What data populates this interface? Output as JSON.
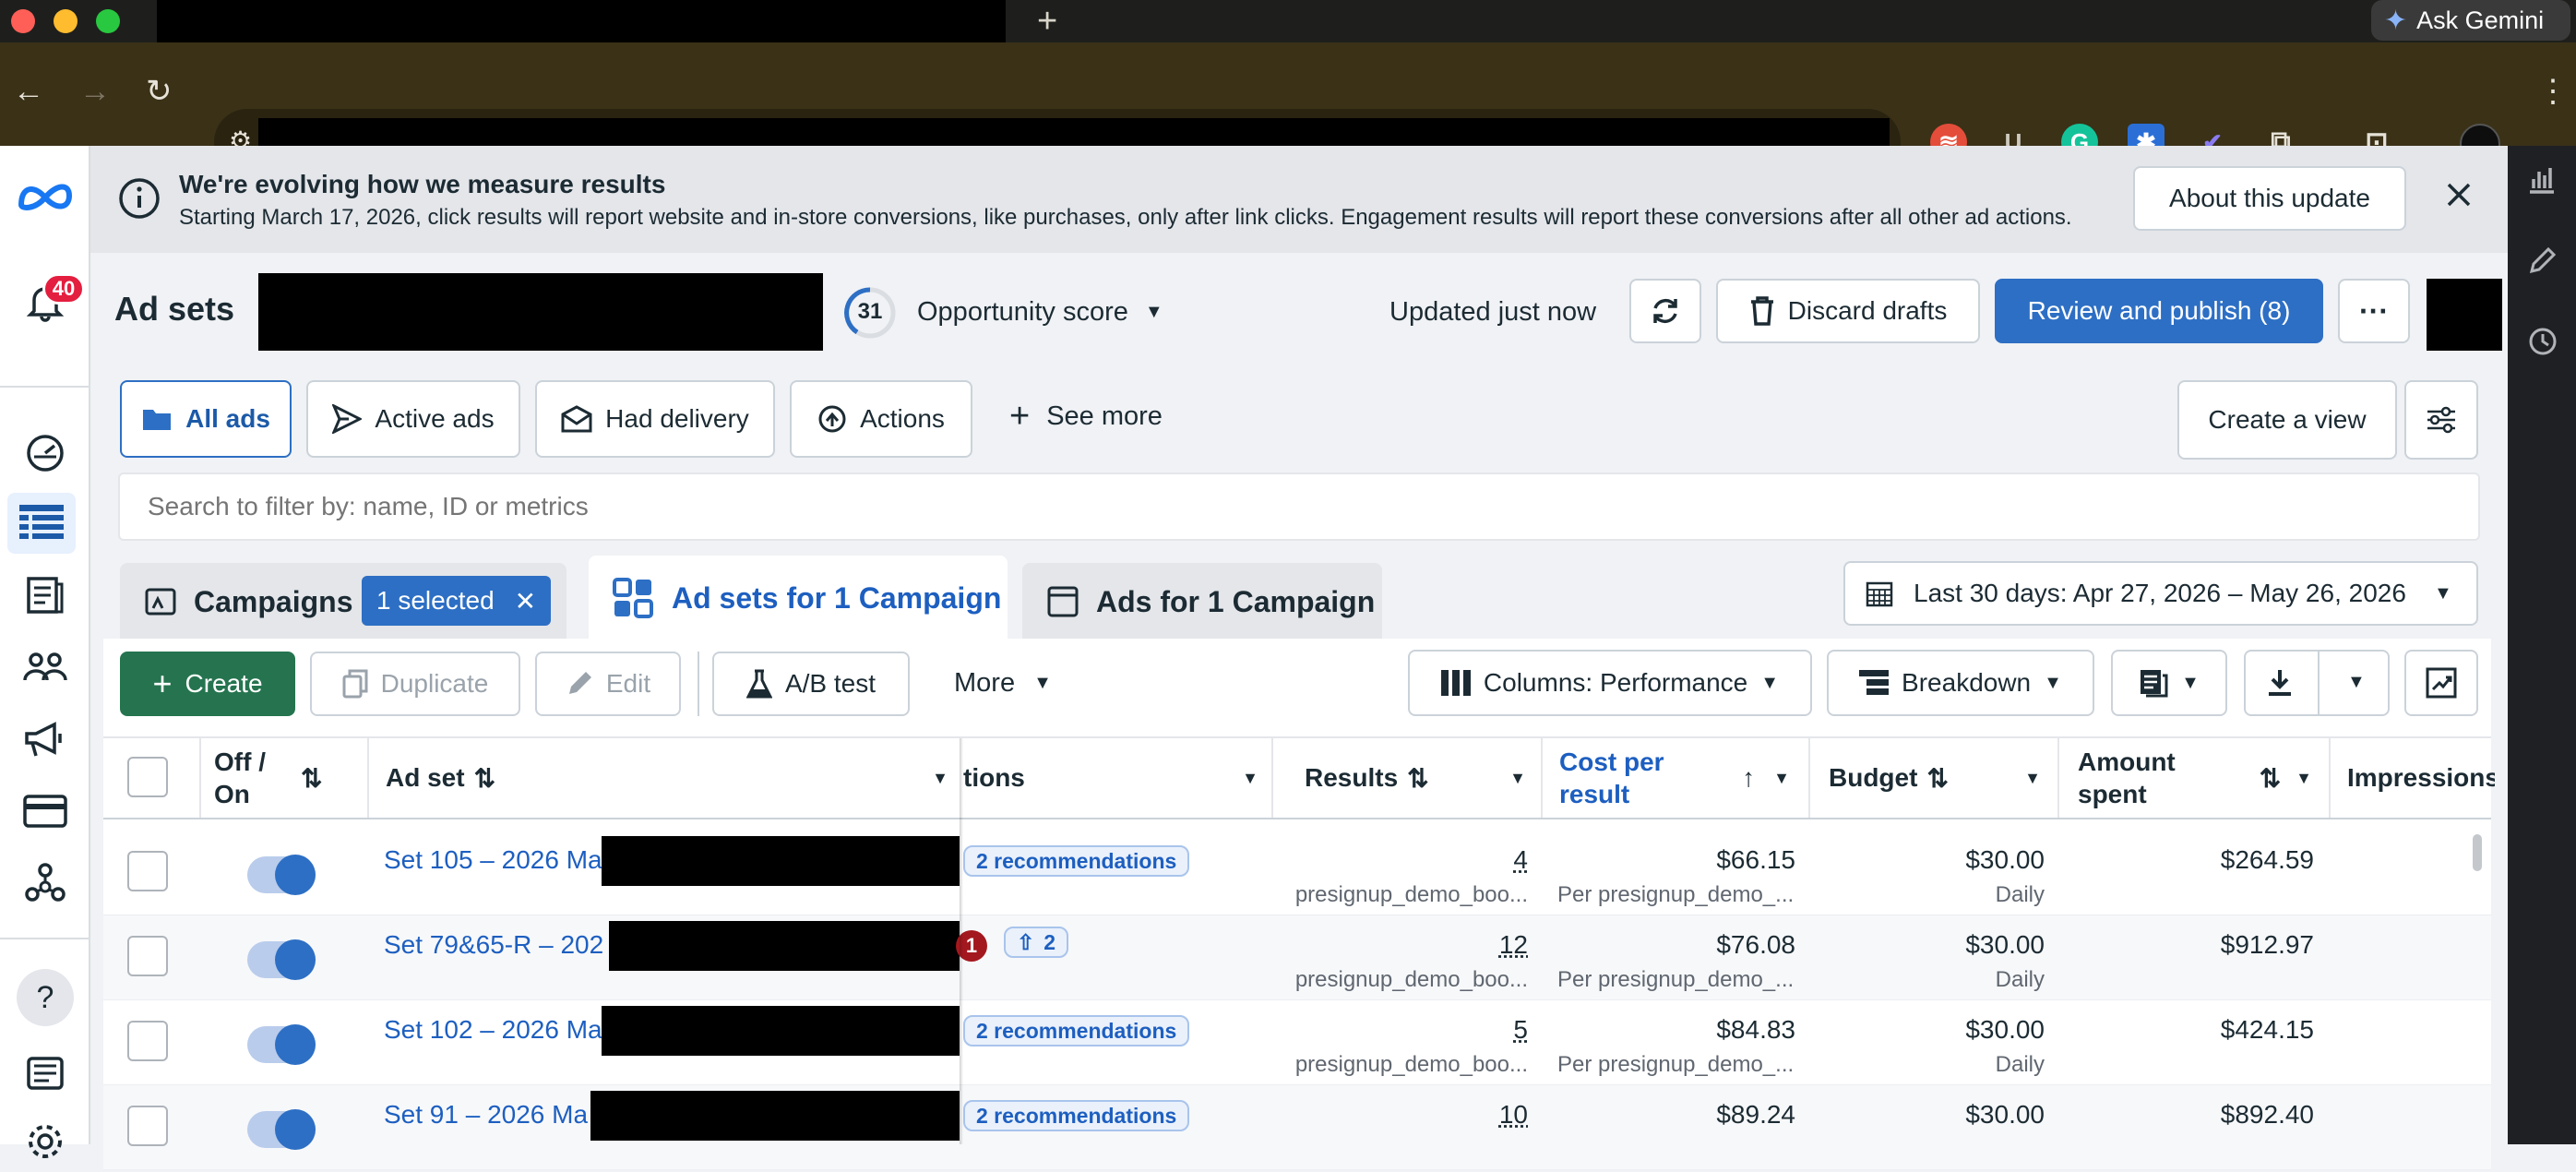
{
  "browser": {
    "gemini_label": "Ask Gemini",
    "new_tab_symbol": "+"
  },
  "left_nav": {
    "notification_count": "40"
  },
  "banner": {
    "title": "We're evolving how we measure results",
    "body": "Starting March 17, 2026, click results will report website and in-store conversions, like purchases, only after link clicks. Engagement results will report these conversions after all other ad actions.",
    "about_button": "About this update"
  },
  "header": {
    "page_title": "Ad sets",
    "opportunity_score_value": "31",
    "opportunity_score_label": "Opportunity score",
    "updated_text": "Updated just now",
    "discard_label": "Discard drafts",
    "review_label": "Review and publish (8)"
  },
  "filters": {
    "all_ads": "All ads",
    "active_ads": "Active ads",
    "had_delivery": "Had delivery",
    "actions": "Actions",
    "see_more": "See more",
    "create_view": "Create a view"
  },
  "search": {
    "placeholder": "Search to filter by: name, ID or metrics"
  },
  "level_tabs": {
    "campaigns": "Campaigns",
    "selected_chip": "1 selected",
    "ad_sets": "Ad sets for 1 Campaign",
    "ads": "Ads for 1 Campaign"
  },
  "date_range": {
    "label": "Last 30 days: Apr 27, 2026 – May 26, 2026"
  },
  "actions_bar": {
    "create": "Create",
    "duplicate": "Duplicate",
    "edit": "Edit",
    "ab_test": "A/B test",
    "more": "More",
    "columns": "Columns: Performance",
    "breakdown": "Breakdown"
  },
  "table": {
    "headers": {
      "off_on": "Off / On",
      "ad_set": "Ad set",
      "actions_partial": "tions",
      "results": "Results",
      "cost_per_result": "Cost per result",
      "budget": "Budget",
      "amount_spent": "Amount spent",
      "impressions": "Impressions"
    },
    "rows": [
      {
        "name": "Set 105 – 2026 Ma",
        "rec": "2 recommendations",
        "results": "4",
        "results_sub": "presignup_demo_boo...",
        "cost": "$66.15",
        "cost_sub": "Per presignup_demo_...",
        "budget": "$30.00",
        "budget_sub": "Daily",
        "spent": "$264.59"
      },
      {
        "name": "Set 79&65-R – 202",
        "rec_alert": "1",
        "rec_count": "2",
        "results": "12",
        "results_sub": "presignup_demo_boo...",
        "cost": "$76.08",
        "cost_sub": "Per presignup_demo_...",
        "budget": "$30.00",
        "budget_sub": "Daily",
        "spent": "$912.97"
      },
      {
        "name": "Set 102 – 2026 Ma",
        "rec": "2 recommendations",
        "results": "5",
        "results_sub": "presignup_demo_boo...",
        "cost": "$84.83",
        "cost_sub": "Per presignup_demo_...",
        "budget": "$30.00",
        "budget_sub": "Daily",
        "spent": "$424.15"
      },
      {
        "name": "Set 91 – 2026 Ma",
        "rec": "2 recommendations",
        "results": "10",
        "results_sub": "",
        "cost": "$89.24",
        "cost_sub": "",
        "budget": "$30.00",
        "budget_sub": "",
        "spent": "$892.40"
      }
    ]
  }
}
